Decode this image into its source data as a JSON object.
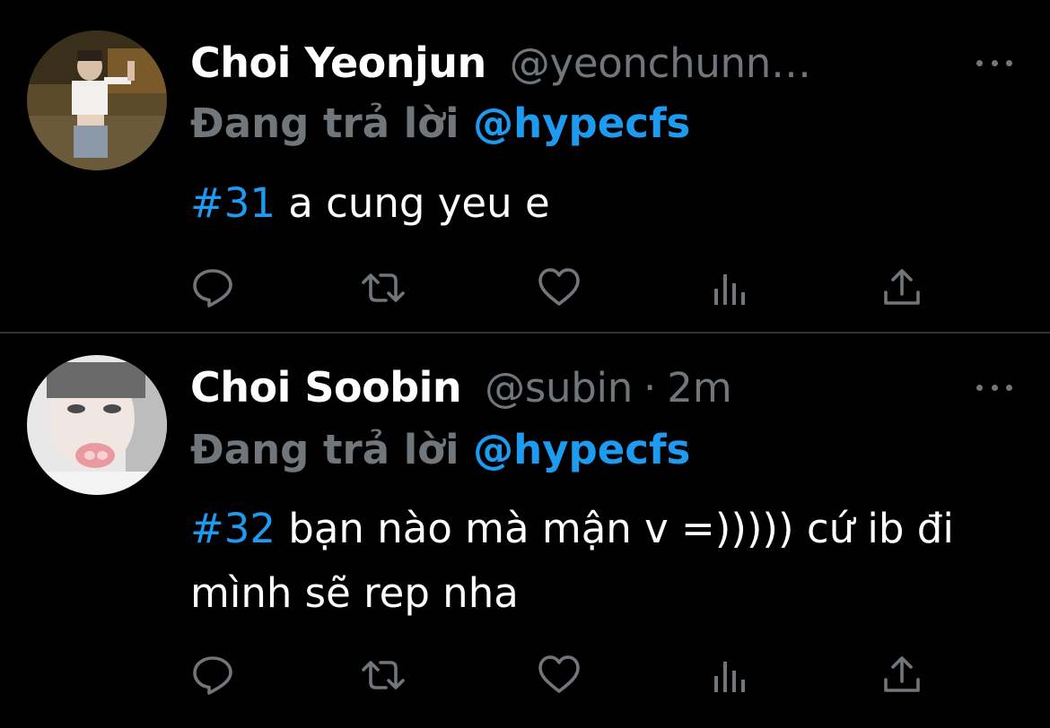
{
  "tweets": [
    {
      "display_name": "Choi Yeonjun",
      "handle": "@yeonchunn…",
      "separator": "",
      "time": "",
      "reply_prefix": "Đang trả lời",
      "reply_to": "@hypecfs",
      "hashtag": "#31",
      "text": " a cung yeu e",
      "avatar": "avatar-photo"
    },
    {
      "display_name": "Choi Soobin",
      "handle": "@subin",
      "separator": "·",
      "time": "2m",
      "reply_prefix": "Đang trả lời",
      "reply_to": "@hypecfs",
      "hashtag": "#32",
      "text": " bạn nào mà mận v =))))) cứ ib đi mình sẽ rep nha",
      "avatar": "avatar-photo"
    }
  ],
  "icons": {
    "reply": "reply-icon",
    "retweet": "retweet-icon",
    "like": "heart-icon",
    "views": "views-icon",
    "share": "share-icon",
    "more": "more-icon"
  },
  "colors": {
    "background": "#000000",
    "text": "#ffffff",
    "secondary": "#71767b",
    "accent": "#1d9bf0",
    "divider": "#2f3336"
  }
}
